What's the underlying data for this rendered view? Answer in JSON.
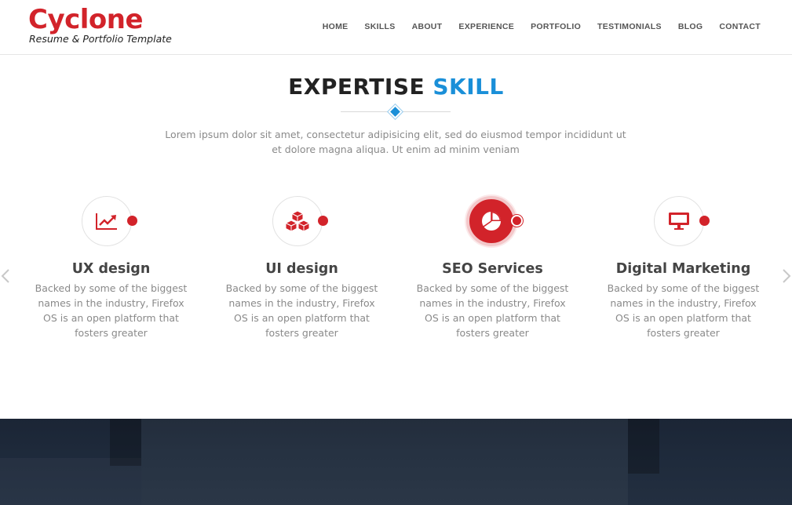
{
  "brand": {
    "title": "Cyclone",
    "tagline": "Resume & Portfolio Template"
  },
  "nav": {
    "items": [
      {
        "label": "HOME"
      },
      {
        "label": "SKILLS"
      },
      {
        "label": "ABOUT"
      },
      {
        "label": "EXPERIENCE"
      },
      {
        "label": "PORTFOLIO"
      },
      {
        "label": "TESTIMONIALS"
      },
      {
        "label": "BLOG"
      },
      {
        "label": "CONTACT"
      }
    ]
  },
  "section": {
    "title_part1": "EXPERTISE",
    "title_part2": "SKILL",
    "description": "Lorem ipsum dolor sit amet, consectetur adipisicing elit, sed do eiusmod tempor incididunt ut et dolore magna aliqua. Ut enim ad minim veniam"
  },
  "skills": [
    {
      "title": "UX design",
      "icon": "trend-chart-icon",
      "active": false,
      "description": "Backed by some of the biggest names in the industry, Firefox OS is an open platform that fosters greater"
    },
    {
      "title": "UI design",
      "icon": "cubes-icon",
      "active": false,
      "description": "Backed by some of the biggest names in the industry, Firefox OS is an open platform that fosters greater"
    },
    {
      "title": "SEO Services",
      "icon": "pie-chart-icon",
      "active": true,
      "description": "Backed by some of the biggest names in the industry, Firefox OS is an open platform that fosters greater"
    },
    {
      "title": "Digital Marketing",
      "icon": "monitor-icon",
      "active": false,
      "description": "Backed by some of the biggest names in the industry, Firefox OS is an open platform that fosters greater"
    }
  ],
  "colors": {
    "brand_red": "#d2232a",
    "accent_blue": "#1a8fd8",
    "dark_banner": "#1e2a3b"
  }
}
